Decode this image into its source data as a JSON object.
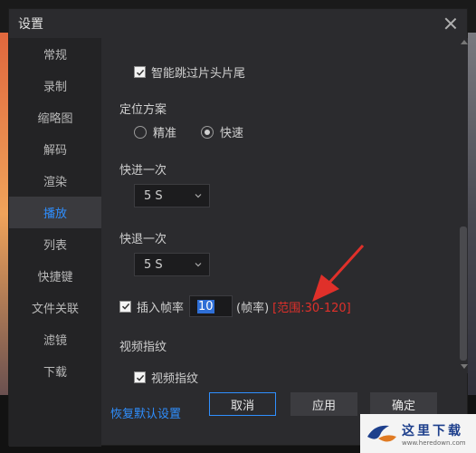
{
  "dialog": {
    "title": "设置"
  },
  "sidebar": {
    "items": [
      {
        "label": "常规"
      },
      {
        "label": "录制"
      },
      {
        "label": "缩略图"
      },
      {
        "label": "解码"
      },
      {
        "label": "渲染"
      },
      {
        "label": "播放",
        "active": true
      },
      {
        "label": "列表"
      },
      {
        "label": "快捷键"
      },
      {
        "label": "文件关联"
      },
      {
        "label": "滤镜"
      },
      {
        "label": "下载"
      }
    ]
  },
  "content": {
    "skip_intro_label": "智能跳过片头片尾",
    "skip_intro_checked": true,
    "position_scheme": {
      "label": "定位方案",
      "options": [
        "精准",
        "快速"
      ],
      "selected": "快速"
    },
    "fast_forward": {
      "label": "快进一次",
      "value": "5 S"
    },
    "rewind": {
      "label": "快退一次",
      "value": "5 S"
    },
    "interpolate": {
      "label": "插入帧率",
      "checked": true,
      "value": "10",
      "unit": "(帧率)",
      "range": "[范围:30-120]"
    },
    "fingerprint": {
      "heading": "视频指纹",
      "checkbox_label": "视频指纹",
      "checked": true
    }
  },
  "footer": {
    "restore_defaults": "恢复默认设置",
    "cancel": "取消",
    "apply": "应用",
    "ok": "确定"
  },
  "watermark": {
    "title": "这里下载",
    "url": "www.heredown.com"
  },
  "colors": {
    "accent": "#2f8fff",
    "annotation": "#e0302a"
  }
}
